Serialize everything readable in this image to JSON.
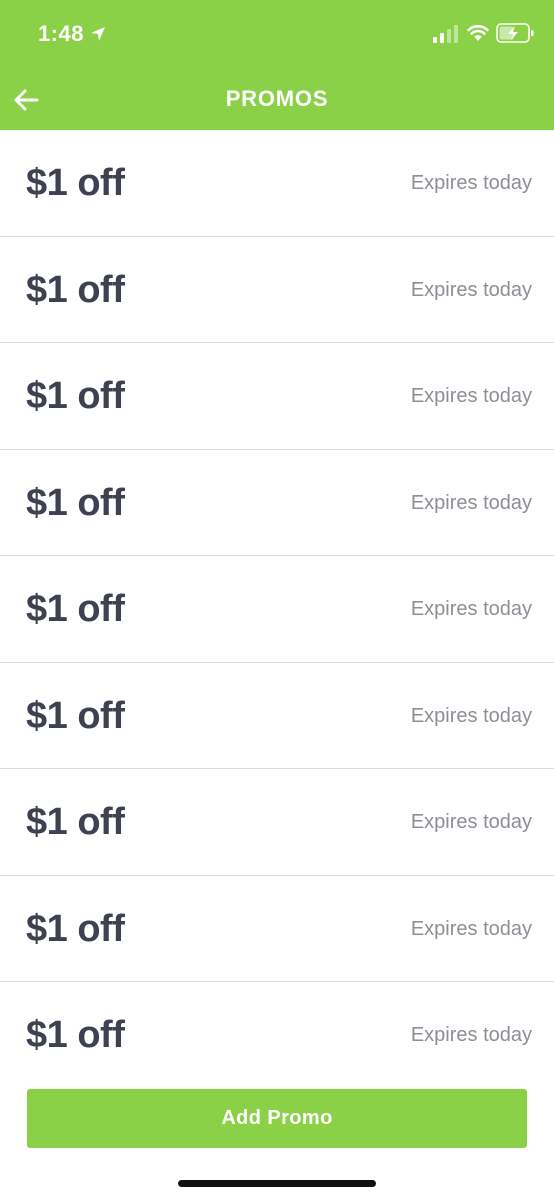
{
  "status_bar": {
    "time": "1:48",
    "icons": [
      "location-arrow-icon",
      "signal-icon",
      "wifi-icon",
      "battery-charging-icon"
    ]
  },
  "nav": {
    "title": "PROMOS",
    "back_icon": "arrow-left-icon"
  },
  "promos": [
    {
      "amount": "$1 off",
      "expiry": "Expires today"
    },
    {
      "amount": "$1 off",
      "expiry": "Expires today"
    },
    {
      "amount": "$1 off",
      "expiry": "Expires today"
    },
    {
      "amount": "$1 off",
      "expiry": "Expires today"
    },
    {
      "amount": "$1 off",
      "expiry": "Expires today"
    },
    {
      "amount": "$1 off",
      "expiry": "Expires today"
    },
    {
      "amount": "$1 off",
      "expiry": "Expires today"
    },
    {
      "amount": "$1 off",
      "expiry": "Expires today"
    },
    {
      "amount": "$1 off",
      "expiry": "Expires today"
    }
  ],
  "add_button": {
    "label": "Add Promo"
  },
  "colors": {
    "brand_green": "#8bd147",
    "amount_text": "#3d4150",
    "expiry_text": "#8e8e96"
  }
}
